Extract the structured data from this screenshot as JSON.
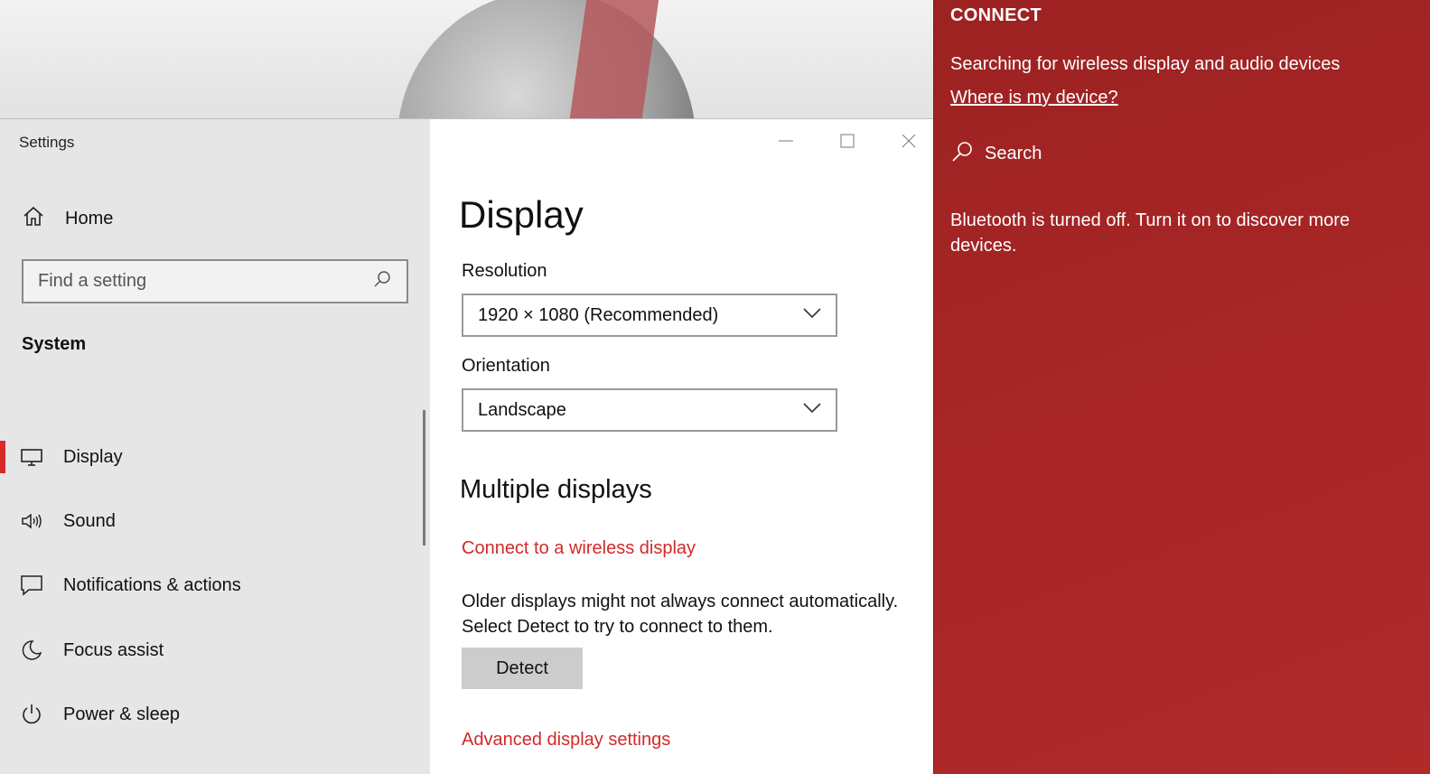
{
  "window": {
    "title": "Settings"
  },
  "sidebar": {
    "home_label": "Home",
    "search_placeholder": "Find a setting",
    "section": "System",
    "items": [
      {
        "label": "Display",
        "icon": "monitor-icon",
        "active": true
      },
      {
        "label": "Sound",
        "icon": "speaker-icon"
      },
      {
        "label": "Notifications & actions",
        "icon": "notification-icon"
      },
      {
        "label": "Focus assist",
        "icon": "moon-icon"
      },
      {
        "label": "Power & sleep",
        "icon": "power-icon"
      }
    ]
  },
  "main": {
    "title": "Display",
    "resolution": {
      "label": "Resolution",
      "value": "1920 × 1080 (Recommended)"
    },
    "orientation": {
      "label": "Orientation",
      "value": "Landscape"
    },
    "multiple_displays": {
      "title": "Multiple displays",
      "connect_link": "Connect to a wireless display",
      "description": "Older displays might not always connect automatically. Select Detect to try to connect to them.",
      "detect_label": "Detect",
      "advanced_link": "Advanced display settings"
    }
  },
  "connect": {
    "title": "CONNECT",
    "status": "Searching for wireless display and audio devices",
    "where_link": "Where is my device?",
    "search_label": "Search",
    "bluetooth_message": "Bluetooth is turned off. Turn it on to discover more devices."
  },
  "colors": {
    "accent": "#d12a2a",
    "flyout_bg": "#a52525"
  }
}
